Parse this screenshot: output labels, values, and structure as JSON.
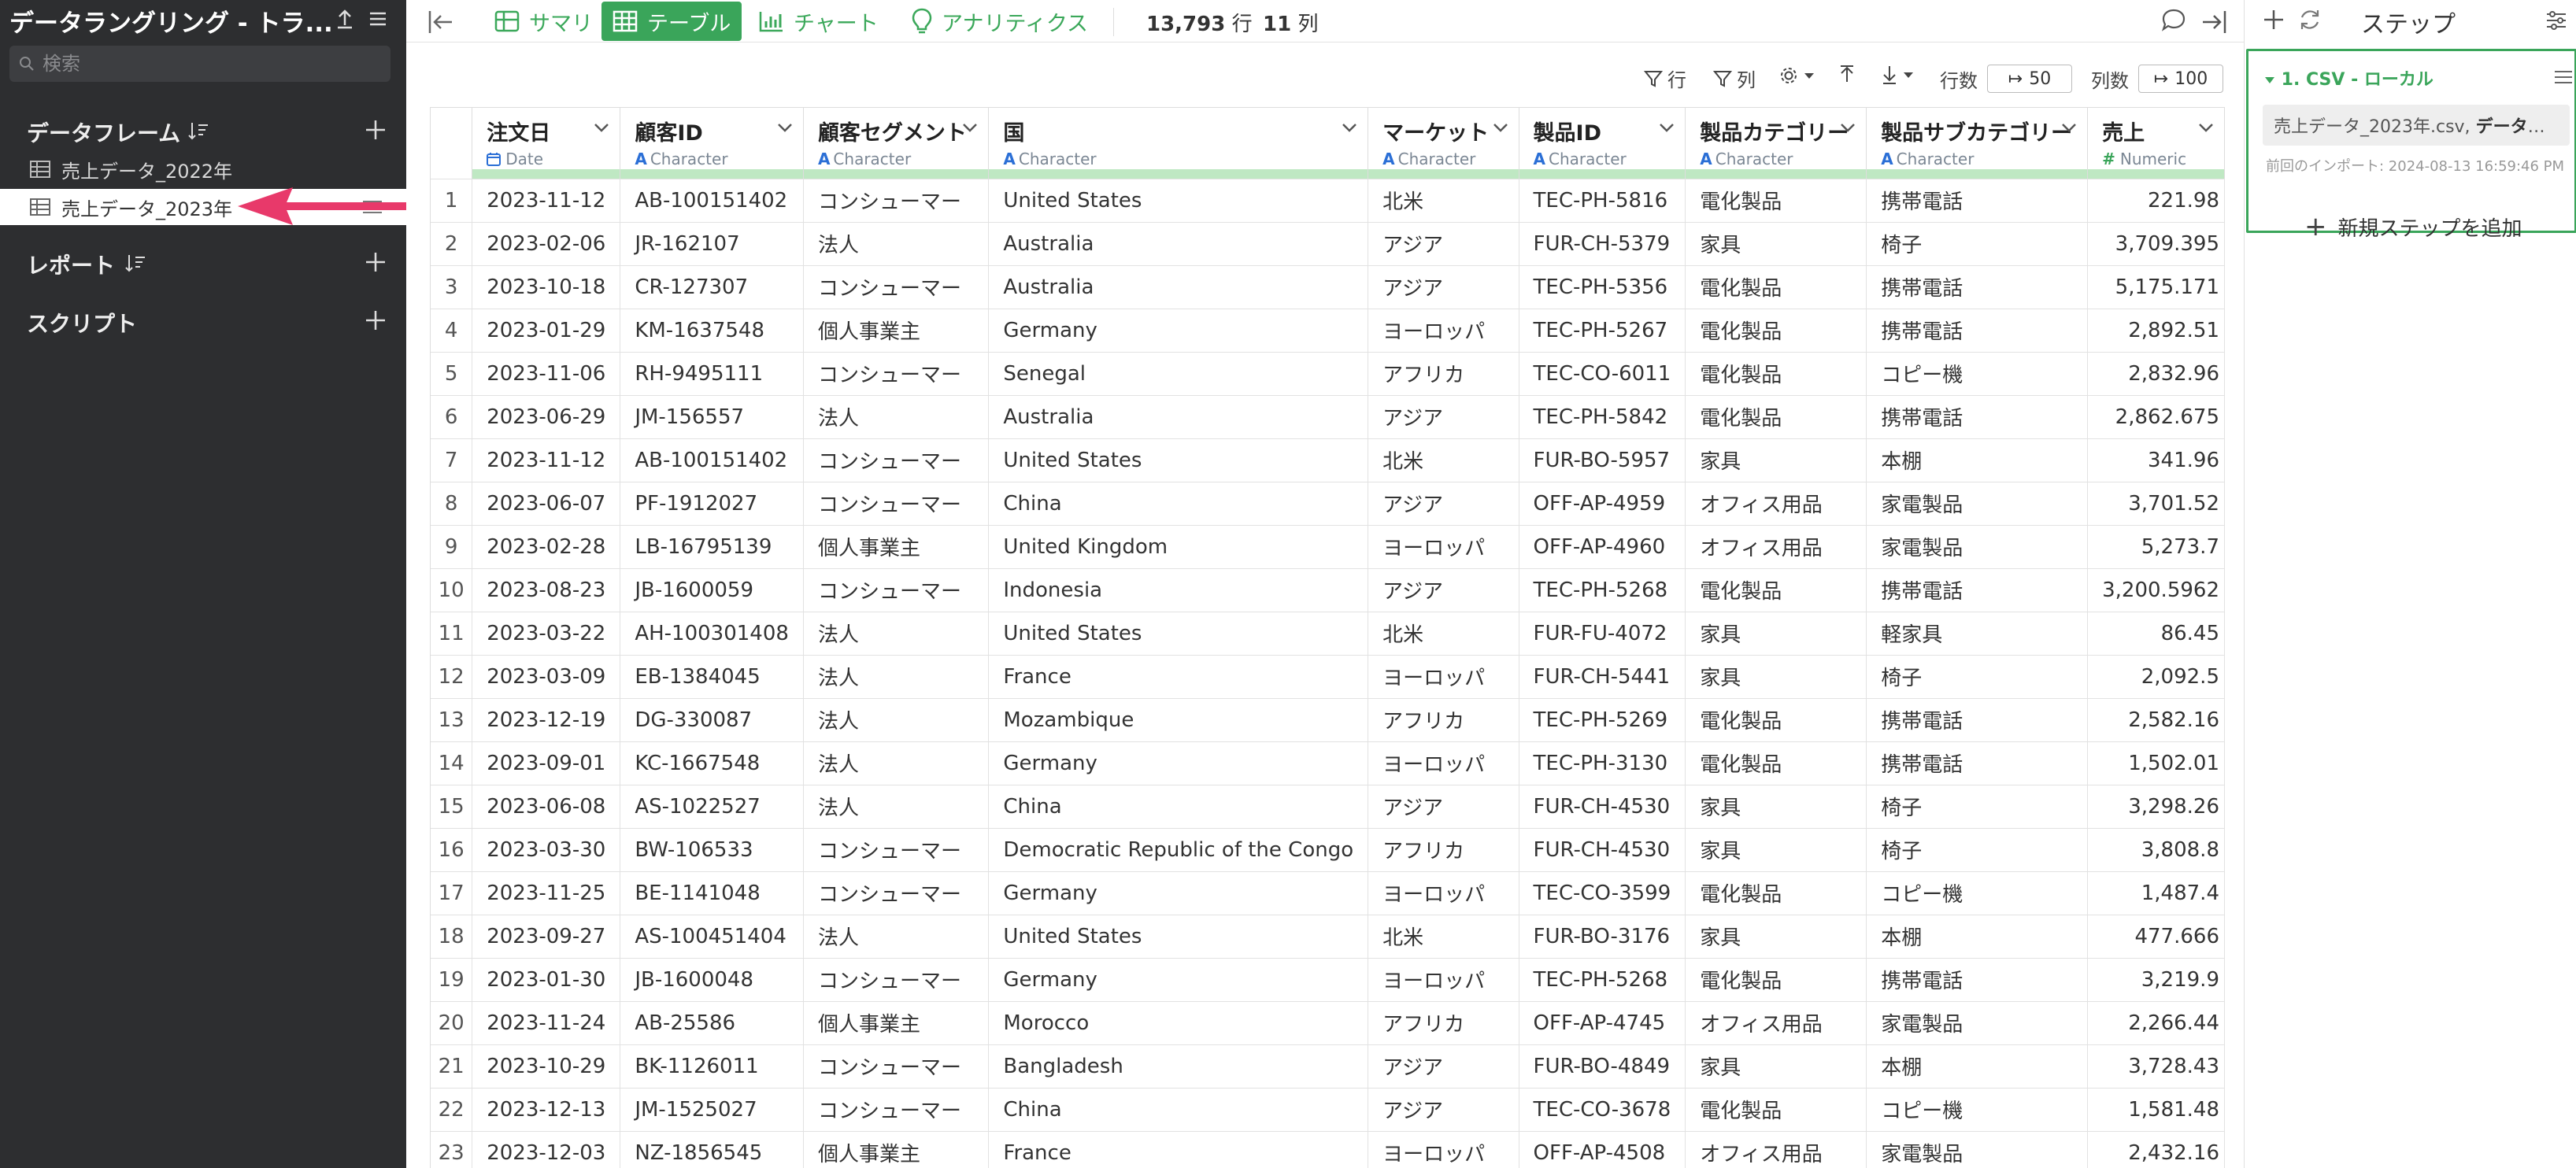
{
  "sidebar": {
    "title": "データラングリング - トラ...",
    "search_placeholder": "検索",
    "sections": {
      "dataframes_label": "データフレーム",
      "reports_label": "レポート",
      "scripts_label": "スクリプト"
    },
    "dataframes": [
      {
        "label": "売上データ_2022年",
        "active": false
      },
      {
        "label": "売上データ_2023年",
        "active": true
      }
    ]
  },
  "toolbar": {
    "tabs": [
      {
        "label": "サマリ",
        "icon": "summary-icon",
        "active": false
      },
      {
        "label": "テーブル",
        "icon": "table-icon",
        "active": true
      },
      {
        "label": "チャート",
        "icon": "chart-icon",
        "active": false
      },
      {
        "label": "アナリティクス",
        "icon": "bulb-icon",
        "active": false
      }
    ],
    "row_count": "13,793",
    "row_unit": "行",
    "col_count": "11",
    "col_unit": "列"
  },
  "subbar": {
    "row_filter_label": "行",
    "col_filter_label": "列",
    "rows_label": "行数",
    "rows_value": "50",
    "cols_label": "列数",
    "cols_value": "100"
  },
  "table": {
    "columns": [
      {
        "name": "注文日",
        "type": "Date",
        "type_icon": "calendar-icon"
      },
      {
        "name": "顧客ID",
        "type": "Character",
        "type_icon": "A"
      },
      {
        "name": "顧客セグメント",
        "type": "Character",
        "type_icon": "A"
      },
      {
        "name": "国",
        "type": "Character",
        "type_icon": "A"
      },
      {
        "name": "マーケット",
        "type": "Character",
        "type_icon": "A"
      },
      {
        "name": "製品ID",
        "type": "Character",
        "type_icon": "A"
      },
      {
        "name": "製品カテゴリー",
        "type": "Character",
        "type_icon": "A"
      },
      {
        "name": "製品サブカテゴリー",
        "type": "Character",
        "type_icon": "A"
      },
      {
        "name": "売上",
        "type": "Numeric",
        "type_icon": "#"
      }
    ],
    "rows": [
      [
        "1",
        "2023-11-12",
        "AB-100151402",
        "コンシューマー",
        "United States",
        "北米",
        "TEC-PH-5816",
        "電化製品",
        "携帯電話",
        "221.98"
      ],
      [
        "2",
        "2023-02-06",
        "JR-162107",
        "法人",
        "Australia",
        "アジア",
        "FUR-CH-5379",
        "家具",
        "椅子",
        "3,709.395"
      ],
      [
        "3",
        "2023-10-18",
        "CR-127307",
        "コンシューマー",
        "Australia",
        "アジア",
        "TEC-PH-5356",
        "電化製品",
        "携帯電話",
        "5,175.171"
      ],
      [
        "4",
        "2023-01-29",
        "KM-1637548",
        "個人事業主",
        "Germany",
        "ヨーロッパ",
        "TEC-PH-5267",
        "電化製品",
        "携帯電話",
        "2,892.51"
      ],
      [
        "5",
        "2023-11-06",
        "RH-9495111",
        "コンシューマー",
        "Senegal",
        "アフリカ",
        "TEC-CO-6011",
        "電化製品",
        "コピー機",
        "2,832.96"
      ],
      [
        "6",
        "2023-06-29",
        "JM-156557",
        "法人",
        "Australia",
        "アジア",
        "TEC-PH-5842",
        "電化製品",
        "携帯電話",
        "2,862.675"
      ],
      [
        "7",
        "2023-11-12",
        "AB-100151402",
        "コンシューマー",
        "United States",
        "北米",
        "FUR-BO-5957",
        "家具",
        "本棚",
        "341.96"
      ],
      [
        "8",
        "2023-06-07",
        "PF-1912027",
        "コンシューマー",
        "China",
        "アジア",
        "OFF-AP-4959",
        "オフィス用品",
        "家電製品",
        "3,701.52"
      ],
      [
        "9",
        "2023-02-28",
        "LB-16795139",
        "個人事業主",
        "United Kingdom",
        "ヨーロッパ",
        "OFF-AP-4960",
        "オフィス用品",
        "家電製品",
        "5,273.7"
      ],
      [
        "10",
        "2023-08-23",
        "JB-1600059",
        "コンシューマー",
        "Indonesia",
        "アジア",
        "TEC-PH-5268",
        "電化製品",
        "携帯電話",
        "3,200.5962"
      ],
      [
        "11",
        "2023-03-22",
        "AH-100301408",
        "法人",
        "United States",
        "北米",
        "FUR-FU-4072",
        "家具",
        "軽家具",
        "86.45"
      ],
      [
        "12",
        "2023-03-09",
        "EB-1384045",
        "法人",
        "France",
        "ヨーロッパ",
        "FUR-CH-5441",
        "家具",
        "椅子",
        "2,092.5"
      ],
      [
        "13",
        "2023-12-19",
        "DG-330087",
        "法人",
        "Mozambique",
        "アフリカ",
        "TEC-PH-5269",
        "電化製品",
        "携帯電話",
        "2,582.16"
      ],
      [
        "14",
        "2023-09-01",
        "KC-1667548",
        "法人",
        "Germany",
        "ヨーロッパ",
        "TEC-PH-3130",
        "電化製品",
        "携帯電話",
        "1,502.01"
      ],
      [
        "15",
        "2023-06-08",
        "AS-1022527",
        "法人",
        "China",
        "アジア",
        "FUR-CH-4530",
        "家具",
        "椅子",
        "3,298.26"
      ],
      [
        "16",
        "2023-03-30",
        "BW-106533",
        "コンシューマー",
        "Democratic Republic of the Congo",
        "アフリカ",
        "FUR-CH-4530",
        "家具",
        "椅子",
        "3,808.8"
      ],
      [
        "17",
        "2023-11-25",
        "BE-1141048",
        "コンシューマー",
        "Germany",
        "ヨーロッパ",
        "TEC-CO-3599",
        "電化製品",
        "コピー機",
        "1,487.4"
      ],
      [
        "18",
        "2023-09-27",
        "AS-100451404",
        "法人",
        "United States",
        "北米",
        "FUR-BO-3176",
        "家具",
        "本棚",
        "477.666"
      ],
      [
        "19",
        "2023-01-30",
        "JB-1600048",
        "コンシューマー",
        "Germany",
        "ヨーロッパ",
        "TEC-PH-5268",
        "電化製品",
        "携帯電話",
        "3,219.9"
      ],
      [
        "20",
        "2023-11-24",
        "AB-25586",
        "個人事業主",
        "Morocco",
        "アフリカ",
        "OFF-AP-4745",
        "オフィス用品",
        "家電製品",
        "2,266.44"
      ],
      [
        "21",
        "2023-10-29",
        "BK-1126011",
        "コンシューマー",
        "Bangladesh",
        "アジア",
        "FUR-BO-4849",
        "家具",
        "本棚",
        "3,728.43"
      ],
      [
        "22",
        "2023-12-13",
        "JM-1525027",
        "コンシューマー",
        "China",
        "アジア",
        "TEC-CO-3678",
        "電化製品",
        "コピー機",
        "1,581.48"
      ],
      [
        "23",
        "2023-12-03",
        "NZ-1856545",
        "個人事業主",
        "France",
        "ヨーロッパ",
        "OFF-AP-4508",
        "オフィス用品",
        "家電製品",
        "2,432.16"
      ]
    ]
  },
  "steps": {
    "title": "ステップ",
    "step1_title": "1. CSV - ローカル",
    "step1_file": "売上データ_2023年.csv,",
    "step1_desc": "データの...",
    "step1_timestamp": "前回のインポート: 2024-08-13 16:59:46 PM",
    "add_label": "新規ステップを追加"
  },
  "colors": {
    "accent_green": "#3aa55a",
    "sidebar_bg": "#2d2e30",
    "pointer_arrow": "#e8396a",
    "type_blue": "#2b6fd6"
  }
}
